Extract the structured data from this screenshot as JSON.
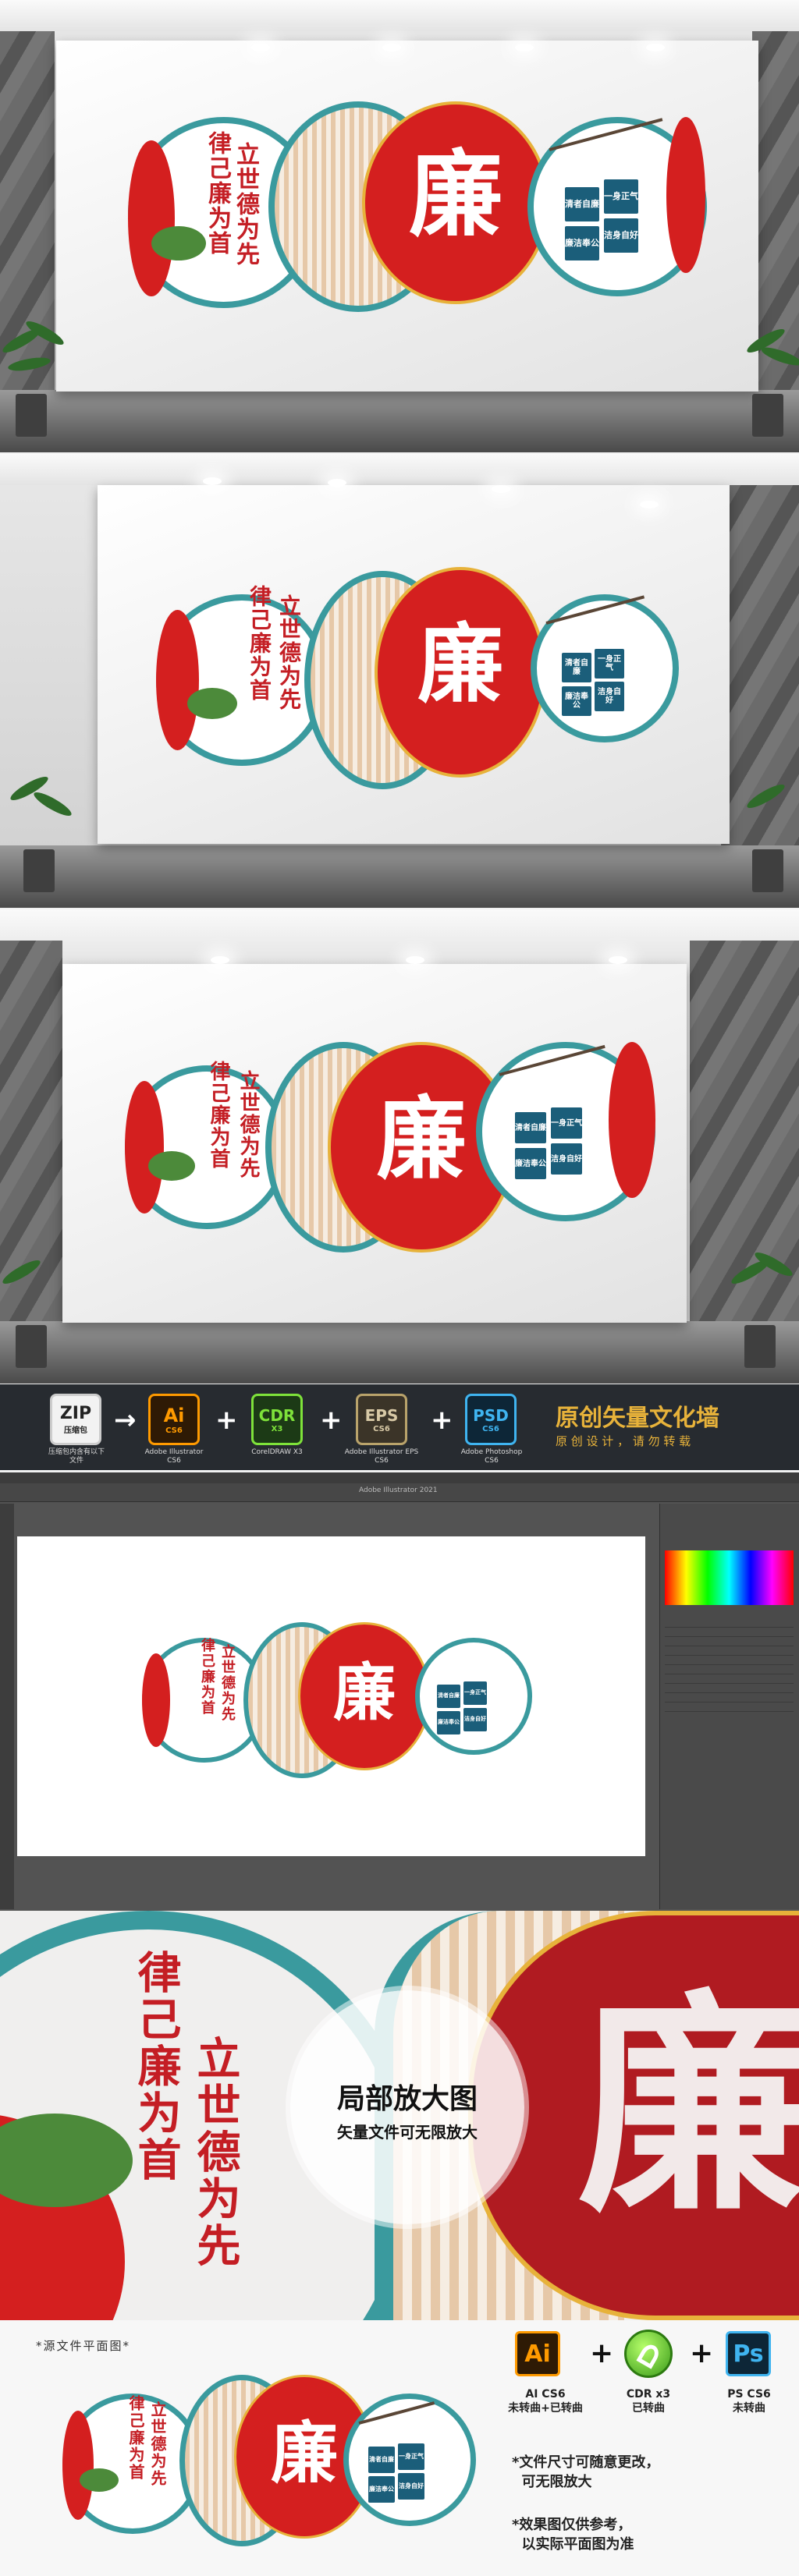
{
  "mural": {
    "main_char": "廉",
    "slogan_right": "立世德为先",
    "slogan_left": "律己廉为首",
    "tiles": [
      "清者自廉",
      "一身正气",
      "廉洁奉公",
      "洁身自好"
    ]
  },
  "banner": {
    "zip_label": "ZIP",
    "zip_sub": "压缩包",
    "zip_caption": "压缩包内含有以下文件",
    "ai_label": "Ai",
    "ai_ver": "CS6",
    "ai_caption": "Adobe Illustrator CS6",
    "cdr_label": "CDR",
    "cdr_ver": "X3",
    "cdr_caption": "CorelDRAW X3",
    "eps_label": "EPS",
    "eps_ver": "CS6",
    "eps_caption": "Adobe Illustrator EPS CS6",
    "psd_label": "PSD",
    "psd_ver": "CS6",
    "psd_caption": "Adobe Photoshop CS6",
    "title": "原创矢量文化墙",
    "subtitle": "原 创 设 计 ， 请 勿 转 载",
    "plus": "+",
    "arrow": "→"
  },
  "editor": {
    "window_title": "Adobe Illustrator 2021"
  },
  "zoom": {
    "title": "局部放大图",
    "subtitle": "矢量文件可无限放大"
  },
  "bottom": {
    "plan_label": "*源文件平面图*",
    "ai_icon": "Ai",
    "ai_caption": "AI CS6\n未转曲+已转曲",
    "cdr_caption": "CDR x3\n已转曲",
    "ps_icon": "Ps",
    "ps_caption": "PS CS6\n未转曲",
    "note1": "*文件尺寸可随意更改，\n  可无限放大",
    "note2": "*效果图仅供参考，\n  以实际平面图为准",
    "plus": "+"
  },
  "colors": {
    "red": "#d41f1f",
    "teal": "#3a9a9e",
    "navy": "#1b5e7a",
    "gold": "#e7b23a"
  }
}
